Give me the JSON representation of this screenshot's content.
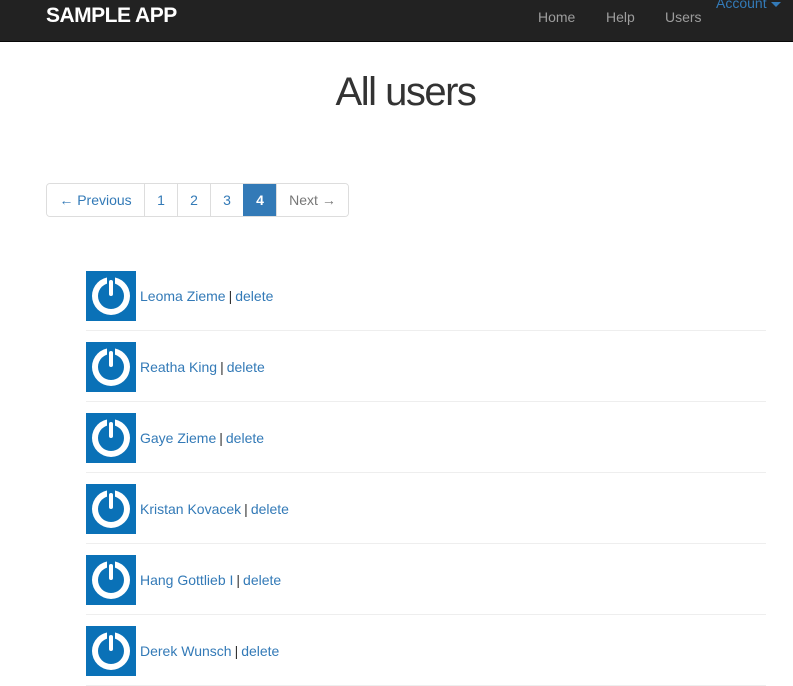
{
  "navbar": {
    "brand": "SAMPLE APP",
    "links": [
      "Home",
      "Help",
      "Users"
    ],
    "account": "Account"
  },
  "page_title": "All users",
  "pagination": {
    "previous": "← Previous",
    "pages": [
      "1",
      "2",
      "3",
      "4"
    ],
    "active_page": "4",
    "next": "Next →"
  },
  "users": [
    {
      "name": "Leoma Zieme",
      "action": "delete"
    },
    {
      "name": "Reatha King",
      "action": "delete"
    },
    {
      "name": "Gaye Zieme",
      "action": "delete"
    },
    {
      "name": "Kristan Kovacek",
      "action": "delete"
    },
    {
      "name": "Hang Gottlieb I",
      "action": "delete"
    },
    {
      "name": "Derek Wunsch",
      "action": "delete"
    }
  ],
  "separator": "|",
  "colors": {
    "navbar_bg": "#222222",
    "link": "#337ab7",
    "active_page_bg": "#337ab7",
    "avatar_bg": "#0a71b7"
  },
  "avatar_icon": "power-icon"
}
